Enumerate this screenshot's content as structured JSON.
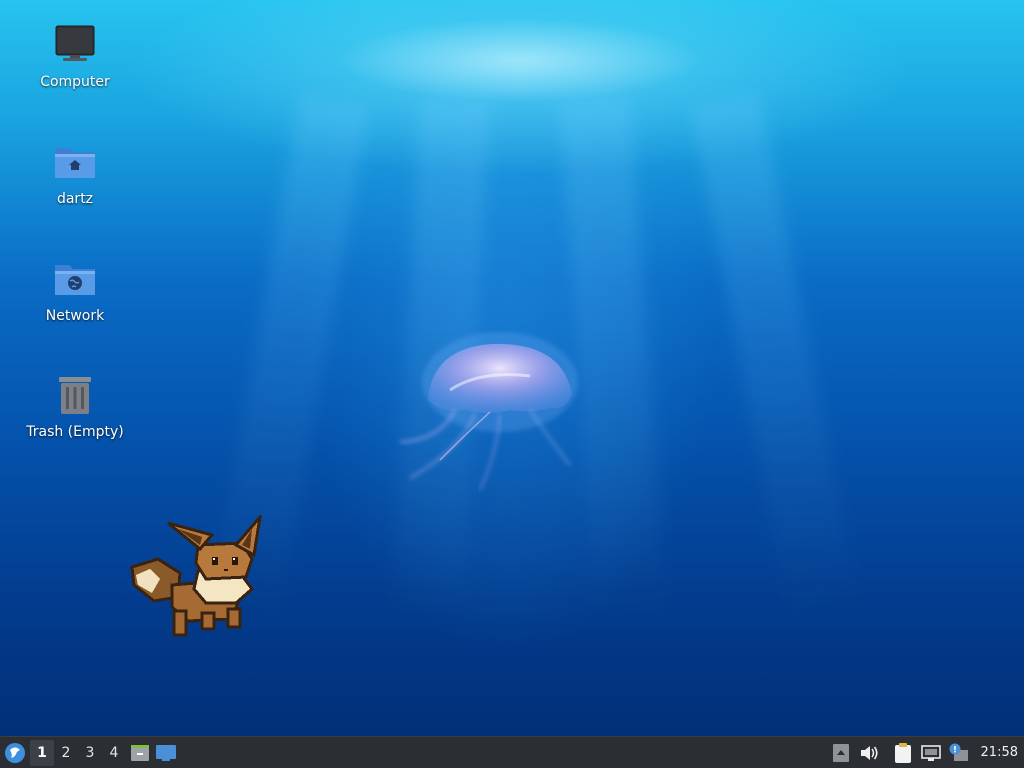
{
  "desktop": {
    "icons": [
      {
        "label": "Computer",
        "icon": "computer-icon"
      },
      {
        "label": "dartz",
        "icon": "home-folder-icon"
      },
      {
        "label": "Network",
        "icon": "network-folder-icon"
      },
      {
        "label": "Trash (Empty)",
        "icon": "trash-icon"
      }
    ],
    "wallpaper": {
      "subject": "jellyfish-underwater",
      "colors": {
        "top": "#27c4ef",
        "mid": "#0a6cc6",
        "bottom": "#022f77"
      }
    }
  },
  "taskbar": {
    "menu_icon": "whisker-menu-icon",
    "workspaces": [
      {
        "label": "1",
        "active": true
      },
      {
        "label": "2",
        "active": false
      },
      {
        "label": "3",
        "active": false
      },
      {
        "label": "4",
        "active": false
      }
    ],
    "launchers": [
      "file-manager-icon",
      "show-desktop-icon"
    ],
    "tray": [
      "tray-expand-icon",
      "volume-icon",
      "clipboard-icon",
      "network-status-icon",
      "notification-icon"
    ],
    "clock": "21:58",
    "colors": {
      "background": "#2b2e33",
      "accent": "#4a90d9"
    }
  }
}
